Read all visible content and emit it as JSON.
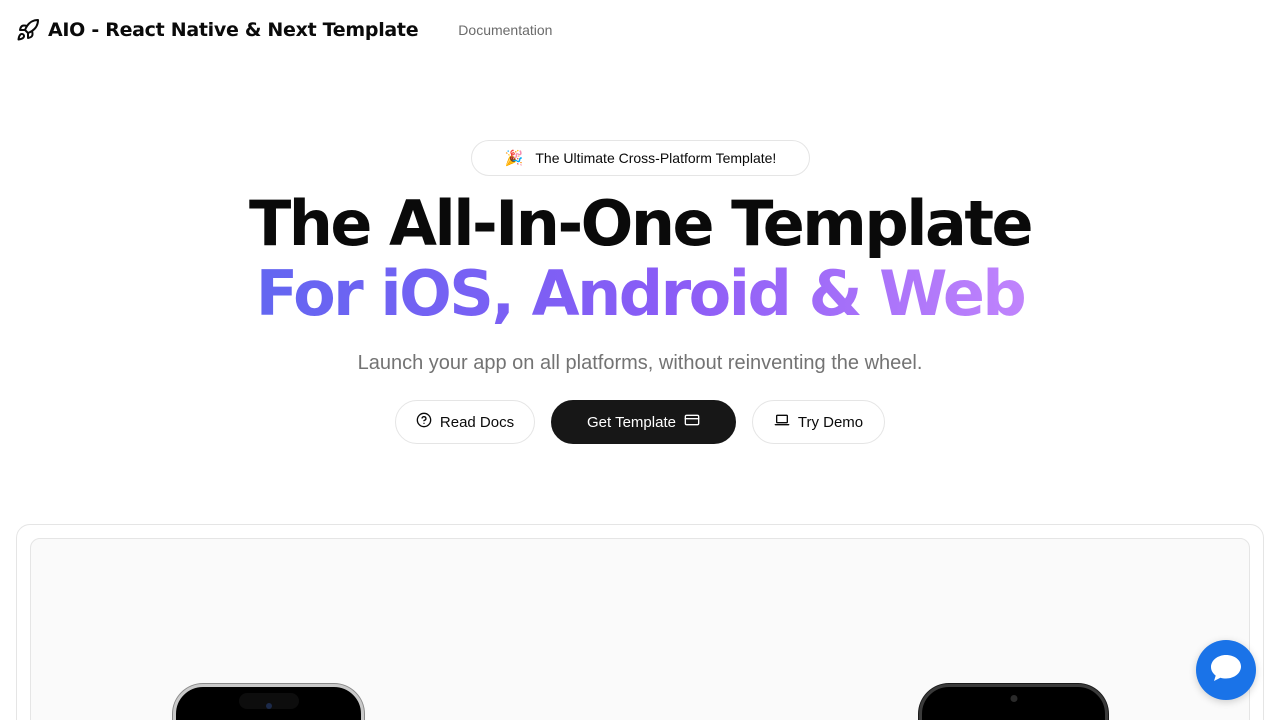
{
  "header": {
    "brand_title": "AIO - React Native & Next Template",
    "brand_icon": "rocket-icon",
    "nav": [
      {
        "label": "Documentation"
      }
    ]
  },
  "hero": {
    "badge": {
      "emoji": "🎉",
      "text": "The Ultimate Cross-Platform Template!"
    },
    "headline_line1": "The All-In-One Template",
    "headline_line2": "For iOS, Android & Web",
    "gradient_colors": [
      "#6366f1",
      "#8b5cf6",
      "#c084fc"
    ],
    "subtitle": "Launch your app on all platforms, without reinventing the wheel."
  },
  "actions": {
    "read_docs": {
      "label": "Read Docs",
      "icon": "help-circle-icon"
    },
    "get_template": {
      "label": "Get Template",
      "icon": "credit-card-icon"
    },
    "try_demo": {
      "label": "Try Demo",
      "icon": "laptop-icon"
    }
  },
  "chat_widget": {
    "icon": "chat-bubble-icon",
    "color": "#1a73e8"
  }
}
